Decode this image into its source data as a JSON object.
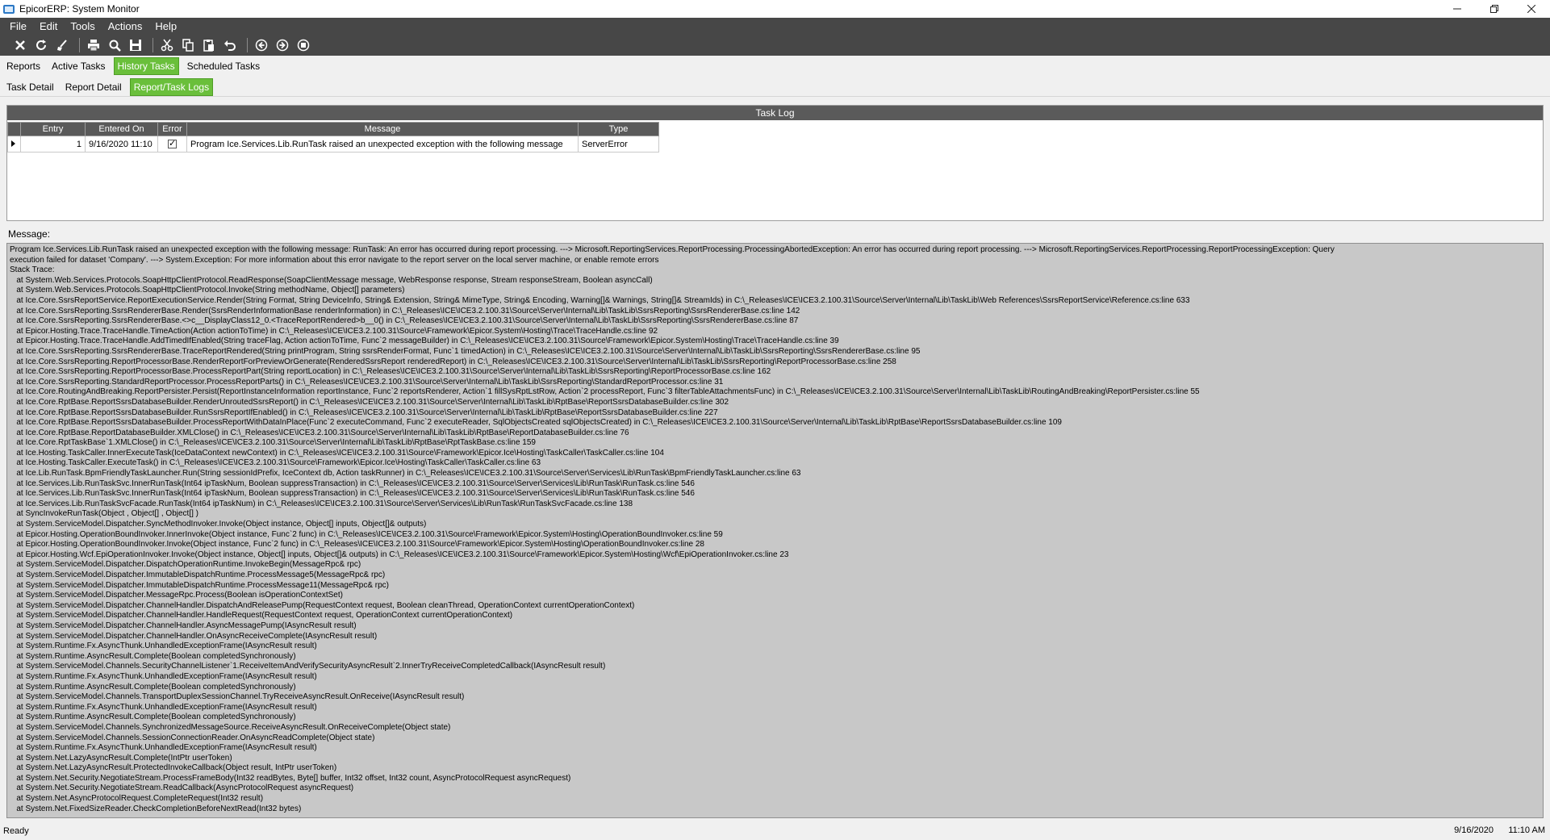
{
  "window": {
    "title": "EpicorERP: System Monitor"
  },
  "menu": [
    "File",
    "Edit",
    "Tools",
    "Actions",
    "Help"
  ],
  "toolbar_icons": [
    "close-icon",
    "refresh-icon",
    "clear-icon",
    "print-icon",
    "print-preview-icon",
    "save-icon",
    "cut-icon",
    "copy-icon",
    "paste-icon",
    "undo-icon",
    "back-icon",
    "forward-icon",
    "stop-icon"
  ],
  "tabs": [
    {
      "label": "Reports",
      "active": false
    },
    {
      "label": "Active Tasks",
      "active": false
    },
    {
      "label": "History Tasks",
      "active": true
    },
    {
      "label": "Scheduled Tasks",
      "active": false
    }
  ],
  "subtabs": [
    {
      "label": "Task Detail",
      "active": false
    },
    {
      "label": "Report Detail",
      "active": false
    },
    {
      "label": "Report/Task Logs",
      "active": true
    }
  ],
  "tasklog": {
    "title": "Task Log",
    "columns": [
      "Entry",
      "Entered On",
      "Error",
      "Message",
      "Type"
    ],
    "rows": [
      {
        "entry": "1",
        "entered_on": "9/16/2020 11:10",
        "error": true,
        "message": "Program Ice.Services.Lib.RunTask raised an unexpected exception with the following message",
        "type": "ServerError"
      }
    ]
  },
  "message": {
    "label": "Message:",
    "lines": [
      "Program Ice.Services.Lib.RunTask raised an unexpected exception with the following message: RunTask: An error has occurred during report processing. ---> Microsoft.ReportingServices.ReportProcessing.ProcessingAbortedException: An error has occurred during report processing. ---> Microsoft.ReportingServices.ReportProcessing.ReportProcessingException: Query",
      "execution failed for dataset 'Company'. ---> System.Exception: For more information about this error navigate to the report server on the local server machine, or enable remote errors",
      "Stack Trace:",
      "   at System.Web.Services.Protocols.SoapHttpClientProtocol.ReadResponse(SoapClientMessage message, WebResponse response, Stream responseStream, Boolean asyncCall)",
      "   at System.Web.Services.Protocols.SoapHttpClientProtocol.Invoke(String methodName, Object[] parameters)",
      "   at Ice.Core.SsrsReportService.ReportExecutionService.Render(String Format, String DeviceInfo, String& Extension, String& MimeType, String& Encoding, Warning[]& Warnings, String[]& StreamIds) in C:\\_Releases\\ICE\\ICE3.2.100.31\\Source\\Server\\Internal\\Lib\\TaskLib\\Web References\\SsrsReportService\\Reference.cs:line 633",
      "   at Ice.Core.SsrsReporting.SsrsRendererBase.Render(SsrsRenderInformationBase renderInformation) in C:\\_Releases\\ICE\\ICE3.2.100.31\\Source\\Server\\Internal\\Lib\\TaskLib\\SsrsReporting\\SsrsRendererBase.cs:line 142",
      "   at Ice.Core.SsrsReporting.SsrsRendererBase.<>c__DisplayClass12_0.<TraceReportRendered>b__0() in C:\\_Releases\\ICE\\ICE3.2.100.31\\Source\\Server\\Internal\\Lib\\TaskLib\\SsrsReporting\\SsrsRendererBase.cs:line 87",
      "   at Epicor.Hosting.Trace.TraceHandle.TimeAction(Action actionToTime) in C:\\_Releases\\ICE\\ICE3.2.100.31\\Source\\Framework\\Epicor.System\\Hosting\\Trace\\TraceHandle.cs:line 92",
      "   at Epicor.Hosting.Trace.TraceHandle.AddTimedIfEnabled(String traceFlag, Action actionToTime, Func`2 messageBuilder) in C:\\_Releases\\ICE\\ICE3.2.100.31\\Source\\Framework\\Epicor.System\\Hosting\\Trace\\TraceHandle.cs:line 39",
      "   at Ice.Core.SsrsReporting.SsrsRendererBase.TraceReportRendered(String printProgram, String ssrsRenderFormat, Func`1 timedAction) in C:\\_Releases\\ICE\\ICE3.2.100.31\\Source\\Server\\Internal\\Lib\\TaskLib\\SsrsReporting\\SsrsRendererBase.cs:line 95",
      "   at Ice.Core.SsrsReporting.ReportProcessorBase.RenderReportForPreviewOrGenerate(RenderedSsrsReport renderedReport) in C:\\_Releases\\ICE\\ICE3.2.100.31\\Source\\Server\\Internal\\Lib\\TaskLib\\SsrsReporting\\ReportProcessorBase.cs:line 258",
      "   at Ice.Core.SsrsReporting.ReportProcessorBase.ProcessReportPart(String reportLocation) in C:\\_Releases\\ICE\\ICE3.2.100.31\\Source\\Server\\Internal\\Lib\\TaskLib\\SsrsReporting\\ReportProcessorBase.cs:line 162",
      "   at Ice.Core.SsrsReporting.StandardReportProcessor.ProcessReportParts() in C:\\_Releases\\ICE\\ICE3.2.100.31\\Source\\Server\\Internal\\Lib\\TaskLib\\SsrsReporting\\StandardReportProcessor.cs:line 31",
      "   at Ice.Core.RoutingAndBreaking.ReportPersister.Persist(ReportInstanceInformation reportInstance, Func`2 reportsRenderer, Action`1 fillSysRptLstRow, Action`2 processReport, Func`3 filterTableAttachmentsFunc) in C:\\_Releases\\ICE\\ICE3.2.100.31\\Source\\Server\\Internal\\Lib\\TaskLib\\RoutingAndBreaking\\ReportPersister.cs:line 55",
      "   at Ice.Core.RptBase.ReportSsrsDatabaseBuilder.RenderUnroutedSsrsReport() in C:\\_Releases\\ICE\\ICE3.2.100.31\\Source\\Server\\Internal\\Lib\\TaskLib\\RptBase\\ReportSsrsDatabaseBuilder.cs:line 302",
      "   at Ice.Core.RptBase.ReportSsrsDatabaseBuilder.RunSsrsReportIfEnabled() in C:\\_Releases\\ICE\\ICE3.2.100.31\\Source\\Server\\Internal\\Lib\\TaskLib\\RptBase\\ReportSsrsDatabaseBuilder.cs:line 227",
      "   at Ice.Core.RptBase.ReportSsrsDatabaseBuilder.ProcessReportWithDataInPlace(Func`2 executeCommand, Func`2 executeReader, SqlObjectsCreated sqlObjectsCreated) in C:\\_Releases\\ICE\\ICE3.2.100.31\\Source\\Server\\Internal\\Lib\\TaskLib\\RptBase\\ReportSsrsDatabaseBuilder.cs:line 109",
      "   at Ice.Core.RptBase.ReportDatabaseBuilder.XMLClose() in C:\\_Releases\\ICE\\ICE3.2.100.31\\Source\\Server\\Internal\\Lib\\TaskLib\\RptBase\\ReportDatabaseBuilder.cs:line 76",
      "   at Ice.Core.RptTaskBase`1.XMLClose() in C:\\_Releases\\ICE\\ICE3.2.100.31\\Source\\Server\\Internal\\Lib\\TaskLib\\RptBase\\RptTaskBase.cs:line 159",
      "   at Ice.Hosting.TaskCaller.InnerExecuteTask(IceDataContext newContext) in C:\\_Releases\\ICE\\ICE3.2.100.31\\Source\\Framework\\Epicor.Ice\\Hosting\\TaskCaller\\TaskCaller.cs:line 104",
      "   at Ice.Hosting.TaskCaller.ExecuteTask() in C:\\_Releases\\ICE\\ICE3.2.100.31\\Source\\Framework\\Epicor.Ice\\Hosting\\TaskCaller\\TaskCaller.cs:line 63",
      "   at Ice.Lib.RunTask.BpmFriendlyTaskLauncher.Run(String sessionIdPrefix, IceContext db, Action taskRunner) in C:\\_Releases\\ICE\\ICE3.2.100.31\\Source\\Server\\Services\\Lib\\RunTask\\BpmFriendlyTaskLauncher.cs:line 63",
      "   at Ice.Services.Lib.RunTaskSvc.InnerRunTask(Int64 ipTaskNum, Boolean suppressTransaction) in C:\\_Releases\\ICE\\ICE3.2.100.31\\Source\\Server\\Services\\Lib\\RunTask\\RunTask.cs:line 546",
      "   at Ice.Services.Lib.RunTaskSvc.InnerRunTask(Int64 ipTaskNum, Boolean suppressTransaction) in C:\\_Releases\\ICE\\ICE3.2.100.31\\Source\\Server\\Services\\Lib\\RunTask\\RunTask.cs:line 546",
      "   at Ice.Services.Lib.RunTaskSvcFacade.RunTask(Int64 ipTaskNum) in C:\\_Releases\\ICE\\ICE3.2.100.31\\Source\\Server\\Services\\Lib\\RunTask\\RunTaskSvcFacade.cs:line 138",
      "   at SyncInvokeRunTask(Object , Object[] , Object[] )",
      "   at System.ServiceModel.Dispatcher.SyncMethodInvoker.Invoke(Object instance, Object[] inputs, Object[]& outputs)",
      "   at Epicor.Hosting.OperationBoundInvoker.InnerInvoke(Object instance, Func`2 func) in C:\\_Releases\\ICE\\ICE3.2.100.31\\Source\\Framework\\Epicor.System\\Hosting\\OperationBoundInvoker.cs:line 59",
      "   at Epicor.Hosting.OperationBoundInvoker.Invoke(Object instance, Func`2 func) in C:\\_Releases\\ICE\\ICE3.2.100.31\\Source\\Framework\\Epicor.System\\Hosting\\OperationBoundInvoker.cs:line 28",
      "   at Epicor.Hosting.Wcf.EpiOperationInvoker.Invoke(Object instance, Object[] inputs, Object[]& outputs) in C:\\_Releases\\ICE\\ICE3.2.100.31\\Source\\Framework\\Epicor.System\\Hosting\\Wcf\\EpiOperationInvoker.cs:line 23",
      "   at System.ServiceModel.Dispatcher.DispatchOperationRuntime.InvokeBegin(MessageRpc& rpc)",
      "   at System.ServiceModel.Dispatcher.ImmutableDispatchRuntime.ProcessMessage5(MessageRpc& rpc)",
      "   at System.ServiceModel.Dispatcher.ImmutableDispatchRuntime.ProcessMessage11(MessageRpc& rpc)",
      "   at System.ServiceModel.Dispatcher.MessageRpc.Process(Boolean isOperationContextSet)",
      "   at System.ServiceModel.Dispatcher.ChannelHandler.DispatchAndReleasePump(RequestContext request, Boolean cleanThread, OperationContext currentOperationContext)",
      "   at System.ServiceModel.Dispatcher.ChannelHandler.HandleRequest(RequestContext request, OperationContext currentOperationContext)",
      "   at System.ServiceModel.Dispatcher.ChannelHandler.AsyncMessagePump(IAsyncResult result)",
      "   at System.ServiceModel.Dispatcher.ChannelHandler.OnAsyncReceiveComplete(IAsyncResult result)",
      "   at System.Runtime.Fx.AsyncThunk.UnhandledExceptionFrame(IAsyncResult result)",
      "   at System.Runtime.AsyncResult.Complete(Boolean completedSynchronously)",
      "   at System.ServiceModel.Channels.SecurityChannelListener`1.ReceiveItemAndVerifySecurityAsyncResult`2.InnerTryReceiveCompletedCallback(IAsyncResult result)",
      "   at System.Runtime.Fx.AsyncThunk.UnhandledExceptionFrame(IAsyncResult result)",
      "   at System.Runtime.AsyncResult.Complete(Boolean completedSynchronously)",
      "   at System.ServiceModel.Channels.TransportDuplexSessionChannel.TryReceiveAsyncResult.OnReceive(IAsyncResult result)",
      "   at System.Runtime.Fx.AsyncThunk.UnhandledExceptionFrame(IAsyncResult result)",
      "   at System.Runtime.AsyncResult.Complete(Boolean completedSynchronously)",
      "   at System.ServiceModel.Channels.SynchronizedMessageSource.ReceiveAsyncResult.OnReceiveComplete(Object state)",
      "   at System.ServiceModel.Channels.SessionConnectionReader.OnAsyncReadComplete(Object state)",
      "   at System.Runtime.Fx.AsyncThunk.UnhandledExceptionFrame(IAsyncResult result)",
      "   at System.Net.LazyAsyncResult.Complete(IntPtr userToken)",
      "   at System.Net.LazyAsyncResult.ProtectedInvokeCallback(Object result, IntPtr userToken)",
      "   at System.Net.Security.NegotiateStream.ProcessFrameBody(Int32 readBytes, Byte[] buffer, Int32 offset, Int32 count, AsyncProtocolRequest asyncRequest)",
      "   at System.Net.Security.NegotiateStream.ReadCallback(AsyncProtocolRequest asyncRequest)",
      "   at System.Net.AsyncProtocolRequest.CompleteRequest(Int32 result)",
      "   at System.Net.FixedSizeReader.CheckCompletionBeforeNextRead(Int32 bytes)"
    ]
  },
  "status": {
    "text": "Ready",
    "date": "9/16/2020",
    "time": "11:10 AM"
  },
  "colors": {
    "dark_bar": "#474747",
    "active_tab": "#6abf3b",
    "message_bg": "#c8c8c8"
  }
}
